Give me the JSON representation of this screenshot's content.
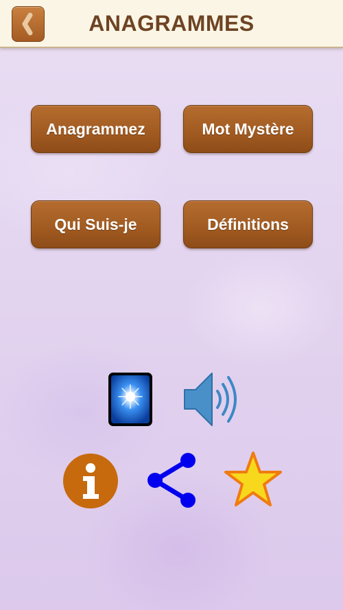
{
  "header": {
    "title": "ANAGRAMMES",
    "back_icon": "chevron-left-icon"
  },
  "menu": {
    "buttons": [
      {
        "label": "Anagrammez"
      },
      {
        "label": "Mot Mystère"
      },
      {
        "label": "Qui Suis-je"
      },
      {
        "label": "Définitions"
      }
    ]
  },
  "controls": {
    "icons": [
      "brightness-icon",
      "volume-icon",
      "info-icon",
      "share-icon",
      "star-icon"
    ]
  },
  "colors": {
    "header_bg": "#fbf5e6",
    "title": "#6e4423",
    "button": "#a55c23",
    "background": "#e6dbf1",
    "info": "#c66a0d",
    "share": "#0000ee",
    "star": "#f8d81c"
  }
}
